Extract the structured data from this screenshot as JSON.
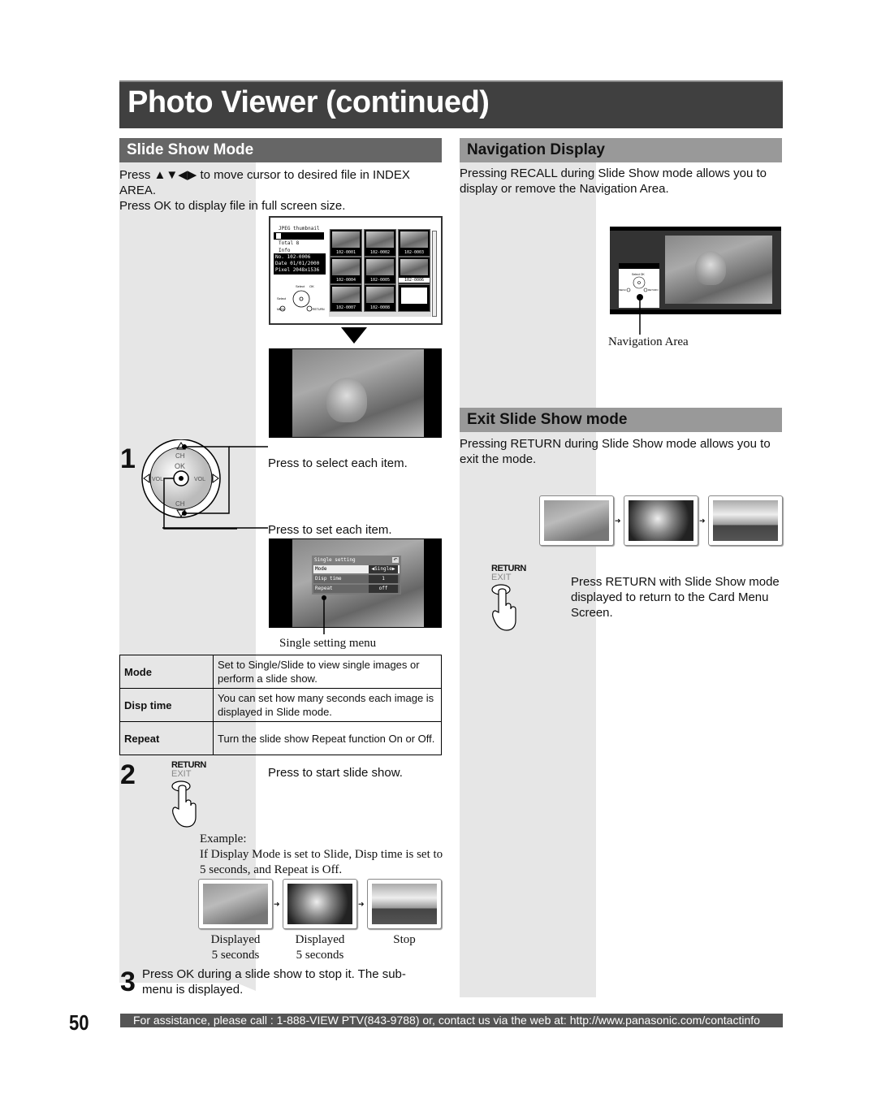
{
  "page": {
    "title": "Photo Viewer (continued)",
    "page_number": "50",
    "footer": "For assistance, please call : 1-888-VIEW PTV(843-9788) or, contact us via the web at: http://www.panasonic.com/contactinfo"
  },
  "slide_show": {
    "heading": "Slide Show Mode",
    "intro_line1": "Press ▲▼◀▶ to move cursor to desired file in INDEX AREA.",
    "intro_line2": "Press OK to display file in full screen size.",
    "thumbnail_screen": {
      "header": "JPEG thumbnail",
      "total": "Total 8",
      "info_label": "Info",
      "no_label": "No.",
      "no_value": "102-0006",
      "date_label": "Date",
      "date_value": "01/01/2000",
      "pixel_label": "Pixel",
      "pixel_value": "2048x1536",
      "nav_select": "Select",
      "nav_ok": "OK",
      "nav_select_left": "Select",
      "nav_menu": "MENU",
      "nav_return": "RETURN",
      "thumbnails": [
        "102-0001",
        "102-0002",
        "102-0003",
        "102-0004",
        "102-0005",
        "102-0006",
        "102-0007",
        "102-0008"
      ]
    },
    "remote": {
      "ch_up": "CH",
      "ch_down": "CH",
      "ok": "OK",
      "vol_left": "VOL",
      "vol_right": "VOL"
    },
    "step1": {
      "number": "1",
      "select_label": "Press to select each item.",
      "set_label": "Press to set each item."
    },
    "single_setting_menu": {
      "title": "Single setting",
      "rows": [
        {
          "label": "Mode",
          "value": "◀Single▶"
        },
        {
          "label": "Disp time",
          "value": "1"
        },
        {
          "label": "Repeat",
          "value": "off"
        }
      ],
      "caption": "Single setting menu"
    },
    "table": [
      {
        "name": "Mode",
        "description": "Set to Single/Slide to view single images or perform a slide show."
      },
      {
        "name": "Disp time",
        "description": "You can set how many seconds each image is displayed in Slide mode."
      },
      {
        "name": "Repeat",
        "description": "Turn the slide show Repeat function On or Off."
      }
    ],
    "step2": {
      "number": "2",
      "button_top": "RETURN",
      "button_bottom": "EXIT",
      "label": "Press to start slide show.",
      "example_title": "Example:",
      "example_text": "If Display Mode is set to Slide, Disp time is set to 5 seconds, and Repeat is Off.",
      "sequence": [
        {
          "line1": "Displayed",
          "line2": "5 seconds"
        },
        {
          "line1": "Displayed",
          "line2": "5 seconds"
        },
        {
          "line1": "Stop",
          "line2": ""
        }
      ]
    },
    "step3": {
      "number": "3",
      "text": "Press OK during a slide show to stop it. The sub-menu is displayed."
    }
  },
  "navigation_display": {
    "heading": "Navigation Display",
    "text": "Pressing RECALL during Slide Show mode allows you to display or remove the Navigation Area.",
    "caption": "Navigation Area",
    "nav_select": "Select",
    "nav_ok": "OK",
    "nav_menu": "MENU",
    "nav_return": "RETURN"
  },
  "exit_slide_show": {
    "heading": "Exit Slide Show mode",
    "text": "Pressing RETURN during Slide Show mode allows you to exit the mode.",
    "button_top": "RETURN",
    "button_bottom": "EXIT",
    "instruction": "Press RETURN with Slide Show mode displayed to return to the Card Menu Screen."
  }
}
